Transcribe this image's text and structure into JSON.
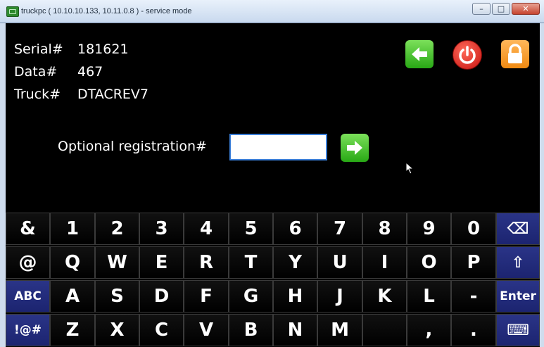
{
  "window": {
    "title": "truckpc ( 10.10.10.133, 10.11.0.8 ) - service mode",
    "minimize": "–",
    "maximize": "□",
    "close": "✕"
  },
  "info": {
    "serial_label": "Serial#",
    "serial_value": "181621",
    "data_label": "Data#",
    "data_value": "467",
    "truck_label": "Truck#",
    "truck_value": "DTACREV7"
  },
  "actions": {
    "back_icon": "arrow-left-icon",
    "power_icon": "power-icon",
    "lock_icon": "lock-icon",
    "back_color": "#3cc21f",
    "power_color": "#e0201b",
    "lock_color": "#f59a1f"
  },
  "registration": {
    "label": "Optional registration#",
    "value": "",
    "go_icon": "arrow-right-icon"
  },
  "keyboard": {
    "row1": [
      "&",
      "1",
      "2",
      "3",
      "4",
      "5",
      "6",
      "7",
      "8",
      "9",
      "0",
      "⌫"
    ],
    "row2": [
      "@",
      "Q",
      "W",
      "E",
      "R",
      "T",
      "Y",
      "U",
      "I",
      "O",
      "P",
      "⇧"
    ],
    "row3": [
      "ABC",
      "A",
      "S",
      "D",
      "F",
      "G",
      "H",
      "J",
      "K",
      "L",
      "-",
      "Enter"
    ],
    "row4": [
      "!@#",
      "Z",
      "X",
      "C",
      "V",
      "B",
      "N",
      "M",
      "",
      ",",
      ".",
      "⌨"
    ]
  }
}
